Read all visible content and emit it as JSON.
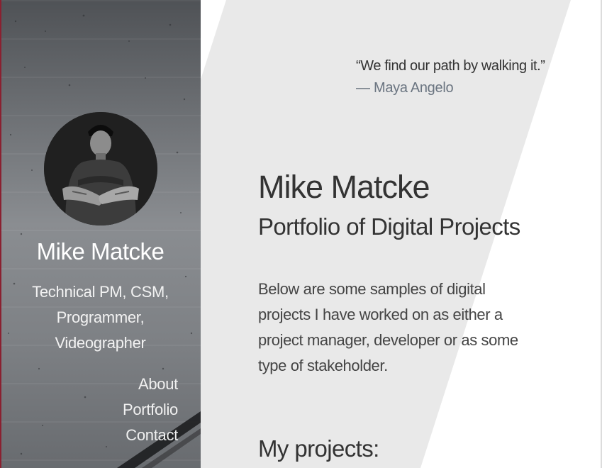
{
  "sidebar": {
    "name": "Mike Matcke",
    "roles": "Technical PM, CSM, Programmer, Videographer",
    "nav": [
      {
        "label": "About"
      },
      {
        "label": "Portfolio"
      },
      {
        "label": "Contact"
      }
    ],
    "accent_color": "#8a2030"
  },
  "main": {
    "quote": "“We find our path by walking it.”",
    "quote_author": "— Maya Angelo",
    "title": "Mike Matcke",
    "subtitle": "Portfolio of Digital Projects",
    "intro": "Below are some samples of digital projects I have worked on as either a project manager, developer or as some type of stakeholder.",
    "projects_heading": "My projects:"
  },
  "colors": {
    "background_shape": "#e9e9e9",
    "text": "#333333",
    "quote_author": "#6a7480"
  }
}
